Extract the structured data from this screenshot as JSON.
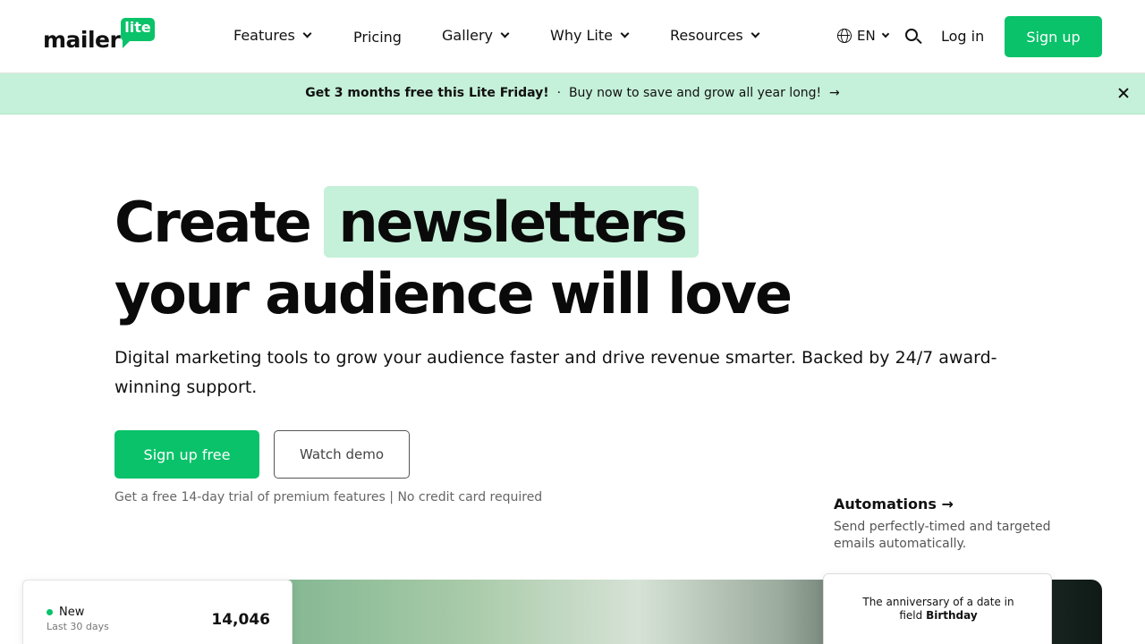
{
  "brand": {
    "name": "mailer",
    "badge": "lite",
    "accent": "#09c269",
    "highlight": "#c5f0d9"
  },
  "nav": {
    "items": [
      {
        "label": "Features",
        "dropdown": true
      },
      {
        "label": "Pricing",
        "dropdown": false
      },
      {
        "label": "Gallery",
        "dropdown": true
      },
      {
        "label": "Why Lite",
        "dropdown": true
      },
      {
        "label": "Resources",
        "dropdown": true
      }
    ],
    "language": "EN",
    "login": "Log in",
    "signup": "Sign up"
  },
  "banner": {
    "bold": "Get 3 months free this Lite Friday!",
    "separator": "·",
    "text": "Buy now to save and grow all year long!",
    "arrow": "→"
  },
  "hero": {
    "title_word1": "Create",
    "title_highlight": "newsletters",
    "title_line2": "your audience will love",
    "subtitle": "Digital marketing tools to grow your audience faster and drive revenue smarter. Backed by 24/7 award-winning support.",
    "cta_primary": "Sign up free",
    "cta_secondary": "Watch demo",
    "trial_note": "Get a free 14-day trial of premium features | No credit card required"
  },
  "automations": {
    "title": "Automations →",
    "description": "Send perfectly-timed and targeted emails automatically."
  },
  "stat_card": {
    "label": "New",
    "period": "Last 30 days",
    "value": "14,046"
  },
  "anniversary_card": {
    "line1": "The anniversary of a date in",
    "line2_prefix": "field",
    "line2_bold": "Birthday"
  }
}
